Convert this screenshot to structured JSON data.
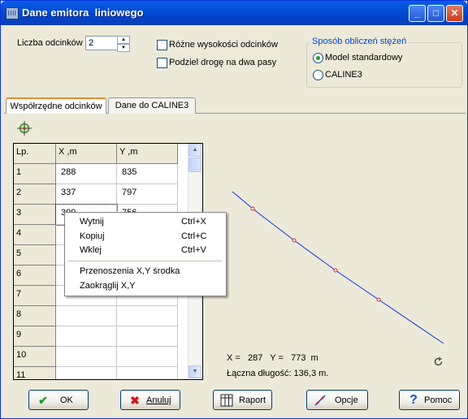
{
  "window": {
    "title": "Dane emitora  liniowego"
  },
  "titlebar": {
    "minimize": "_",
    "maximize": "□",
    "close": "✕"
  },
  "top": {
    "segments_label": "Liczba odcinków",
    "segments_value": "2",
    "checkbox_heights": "Różne wysokości odcinków",
    "checkbox_split": "Podziel drogę na dwa pasy",
    "group_title": "Sposób obliczeń stężeń",
    "radio_standard": "Model standardowy",
    "radio_caline": "CALINE3",
    "radio_selected": "standard"
  },
  "tabs": [
    "Współrzędne odcinków",
    "Dane do CALINE3"
  ],
  "table": {
    "headers": [
      "Lp.",
      "X ,m",
      "Y ,m"
    ],
    "rows": [
      [
        "1",
        "288",
        "835"
      ],
      [
        "2",
        "337",
        "797"
      ],
      [
        "3",
        "399",
        "756"
      ],
      [
        "4",
        "",
        ""
      ],
      [
        "5",
        "",
        ""
      ],
      [
        "6",
        "",
        ""
      ],
      [
        "7",
        "",
        ""
      ],
      [
        "8",
        "",
        ""
      ],
      [
        "9",
        "",
        ""
      ],
      [
        "10",
        "",
        ""
      ],
      [
        "11",
        "",
        ""
      ]
    ]
  },
  "context_menu": [
    {
      "label": "Wytnij",
      "shortcut": "Ctrl+X"
    },
    {
      "label": "Kopiuj",
      "shortcut": "Ctrl+C"
    },
    {
      "label": "Wklej",
      "shortcut": "Ctrl+V"
    },
    {
      "label": "Przenoszenia X,Y środka",
      "shortcut": ""
    },
    {
      "label": "Zaokrąglij  X,Y",
      "shortcut": ""
    }
  ],
  "plot_info": {
    "coords": "X =   287   Y =   773  m",
    "length": "Łączna długość: 136,3 m."
  },
  "buttons": {
    "ok": "OK",
    "cancel": "Anuluj",
    "report": "Raport",
    "options": "Opcje",
    "help": "Pomoc"
  },
  "colors": {
    "plot_line": "#1030e0",
    "plot_marker": "#e02020",
    "accent": "#0046d5"
  }
}
